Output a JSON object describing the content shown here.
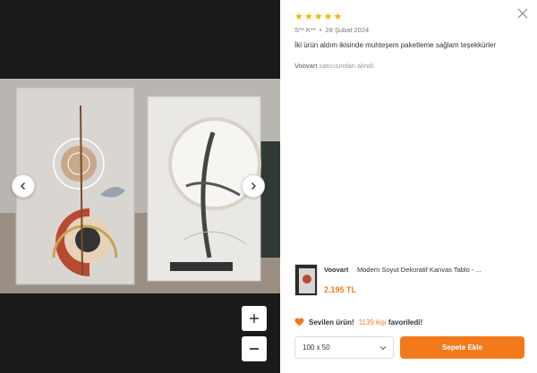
{
  "review": {
    "rating": 5,
    "stars": [
      "★",
      "★",
      "★",
      "★",
      "★"
    ],
    "author": "S** K**",
    "date": "28 Şubat 2024",
    "comment": "İki ürün aldım ikisinde muhteşem paketleme sağlam teşekkürler",
    "seller_name": "Voovart",
    "seller_suffix": "satıcısından alındı."
  },
  "product": {
    "brand": "Voovart",
    "name": "Modern Soyut Dekoratif Kanvas Tablo - ...",
    "price": "2.195 TL"
  },
  "favorite": {
    "prefix": "Sevilen ürün!",
    "count": "1139 kişi",
    "suffix": "favoriledi!"
  },
  "size_select": {
    "value": "100 x 50"
  },
  "cart_button": {
    "label": "Sepete Ekle"
  },
  "colors": {
    "accent": "#f27a1a",
    "star": "#f5b400"
  },
  "icons": [
    "close-icon",
    "chevron-left-icon",
    "chevron-right-icon",
    "zoom-in-icon",
    "zoom-out-icon",
    "heart-icon",
    "chevron-down-icon",
    "star-icon"
  ]
}
